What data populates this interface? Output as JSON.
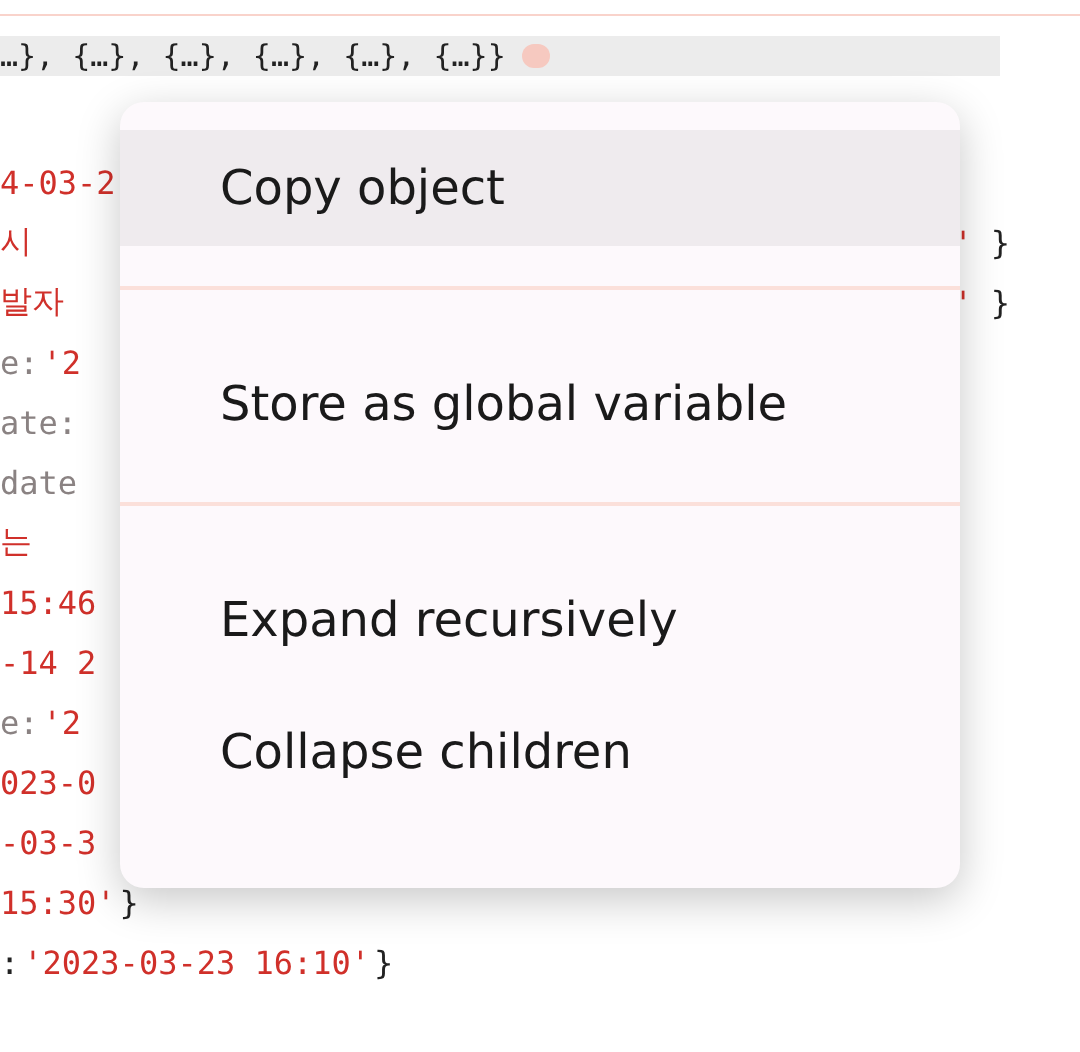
{
  "console": {
    "summary": {
      "text": "…}, {…}, {…}, {…}, {…}, {…}}",
      "badge": true
    },
    "lines": [
      {
        "left": [
          {
            "kind": "string",
            "text": "4-03-2"
          }
        ]
      },
      {
        "left": [
          {
            "kind": "string",
            "text": "시"
          }
        ],
        "right": [
          {
            "kind": "string",
            "text": "'"
          },
          {
            "kind": "punct",
            "text": "}"
          }
        ]
      },
      {
        "left": [
          {
            "kind": "string",
            "text": "발자"
          }
        ],
        "right": [
          {
            "kind": "string",
            "text": "'"
          },
          {
            "kind": "punct",
            "text": "}"
          }
        ]
      },
      {
        "left": [
          {
            "kind": "key",
            "text": "e:"
          },
          {
            "kind": "string",
            "text": "'2"
          }
        ]
      },
      {
        "left": [
          {
            "kind": "key",
            "text": "ate:"
          }
        ]
      },
      {
        "left": [
          {
            "kind": "key",
            "text": "date"
          }
        ]
      },
      {
        "left": [
          {
            "kind": "string",
            "text": "는"
          }
        ]
      },
      {
        "left": [
          {
            "kind": "string",
            "text": "15:46"
          }
        ]
      },
      {
        "left": [
          {
            "kind": "string",
            "text": "-14 2"
          }
        ]
      },
      {
        "left": [
          {
            "kind": "key",
            "text": "e:"
          },
          {
            "kind": "string",
            "text": "'2"
          }
        ]
      },
      {
        "left": [
          {
            "kind": "string",
            "text": "023-0"
          }
        ]
      },
      {
        "left": [
          {
            "kind": "string",
            "text": "-03-3"
          }
        ]
      },
      {
        "left": [
          {
            "kind": "string",
            "text": "15:30'"
          },
          {
            "kind": "punct",
            "text": "}"
          }
        ]
      },
      {
        "left": [
          {
            "kind": "punct",
            "text": ":"
          },
          {
            "kind": "string",
            "text": "'2023-03-23 16:10'"
          },
          {
            "kind": "punct",
            "text": "}"
          }
        ]
      }
    ]
  },
  "context_menu": {
    "groups": [
      [
        {
          "label": "Copy object",
          "selected": true
        }
      ],
      [
        {
          "label": "Store as global variable",
          "selected": false
        }
      ],
      [
        {
          "label": "Expand recursively",
          "selected": false
        },
        {
          "label": "Collapse children",
          "selected": false
        }
      ]
    ]
  }
}
